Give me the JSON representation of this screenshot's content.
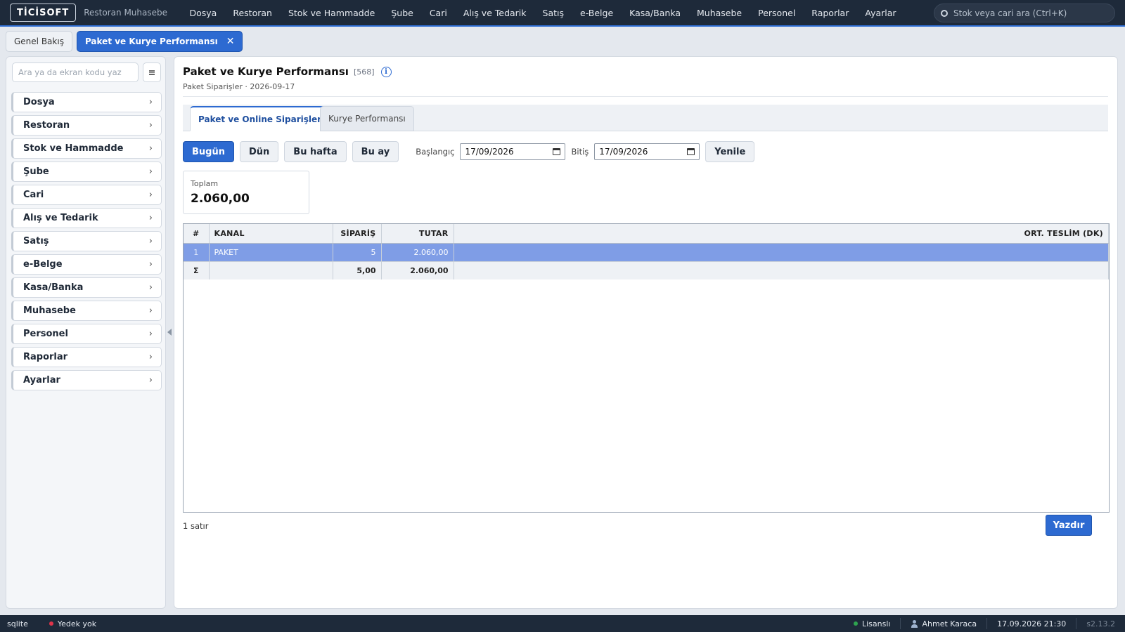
{
  "topbar": {
    "logo": "TİCİSOFT",
    "app_name": "Restoran Muhasebe",
    "menu": [
      "Dosya",
      "Restoran",
      "Stok ve Hammadde",
      "Şube",
      "Cari",
      "Alış ve Tedarik",
      "Satış",
      "e-Belge",
      "Kasa/Banka",
      "Muhasebe",
      "Personel",
      "Raporlar",
      "Ayarlar"
    ],
    "search_placeholder": "Stok veya cari ara (Ctrl+K)",
    "search_icon": "search-icon"
  },
  "tabs": {
    "home": "Genel Bakış",
    "active": "Paket ve Kurye Performansı",
    "close": "✕"
  },
  "sidebar": {
    "search_placeholder": "Ara ya da ekran kodu yaz",
    "items": [
      "Dosya",
      "Restoran",
      "Stok ve Hammadde",
      "Şube",
      "Cari",
      "Alış ve Tedarik",
      "Satış",
      "e-Belge",
      "Kasa/Banka",
      "Muhasebe",
      "Personel",
      "Raporlar",
      "Ayarlar"
    ],
    "chevron": "›"
  },
  "page": {
    "title": "Paket ve Kurye Performansı",
    "code": "[568]",
    "info": "i",
    "subtitle": "Paket Siparişler · 2026-09-17",
    "view_tabs": [
      "Paket ve Online Siparişler",
      "Kurye Performansı"
    ]
  },
  "filters": {
    "today": "Bugün",
    "yesterday": "Dün",
    "this_week": "Bu hafta",
    "this_month": "Bu ay",
    "start_label": "Başlangıç",
    "start_value": "17/09/2026",
    "end_label": "Bitiş",
    "end_value": "17/09/2026",
    "refresh": "Yenile"
  },
  "summary": {
    "label": "Toplam",
    "value": "2.060,00"
  },
  "grid": {
    "headers": {
      "idx": "#",
      "kanal": "KANAL",
      "siparis": "SİPARİŞ",
      "tutar": "TUTAR",
      "ort": "ORT. TESLİM (DK)"
    },
    "rows": [
      {
        "idx": "1",
        "kanal": "PAKET",
        "siparis": "5",
        "tutar": "2.060,00",
        "ort": ""
      }
    ],
    "sum": {
      "idx": "Σ",
      "kanal": "",
      "siparis": "5,00",
      "tutar": "2.060,00",
      "ort": ""
    }
  },
  "footer": {
    "row_count": "1 satır",
    "print": "Yazdır"
  },
  "statusbar": {
    "db": "sqlite",
    "backup": "Yedek yok",
    "backup_color": "#e0344a",
    "license": "Lisanslı",
    "license_color": "#2ea44f",
    "user": "Ahmet Karaca",
    "datetime": "17.09.2026 21:30",
    "version": "s2.13.2"
  }
}
